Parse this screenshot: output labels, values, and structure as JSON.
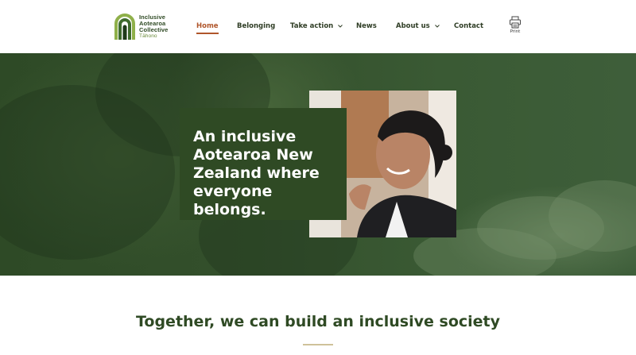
{
  "logo": {
    "line1": "Inclusive",
    "line2": "Aotearoa",
    "line3": "Collective",
    "line4": "Tāhono"
  },
  "nav": {
    "items": [
      {
        "label": "Home",
        "active": true,
        "has_dropdown": false
      },
      {
        "label": "Belonging",
        "active": false,
        "has_dropdown": false
      },
      {
        "label": "Take action",
        "active": false,
        "has_dropdown": true
      },
      {
        "label": "News",
        "active": false,
        "has_dropdown": false
      },
      {
        "label": "About us",
        "active": false,
        "has_dropdown": true
      },
      {
        "label": "Contact",
        "active": false,
        "has_dropdown": false
      }
    ],
    "print_label": "Print"
  },
  "hero": {
    "title": "An inclusive Aotearoa New Zealand where everyone belongs."
  },
  "section": {
    "title": "Together, we can build an inclusive society"
  },
  "colors": {
    "brand_green": "#2f4a24",
    "accent": "#b0562b",
    "rule": "#cfc29a"
  }
}
